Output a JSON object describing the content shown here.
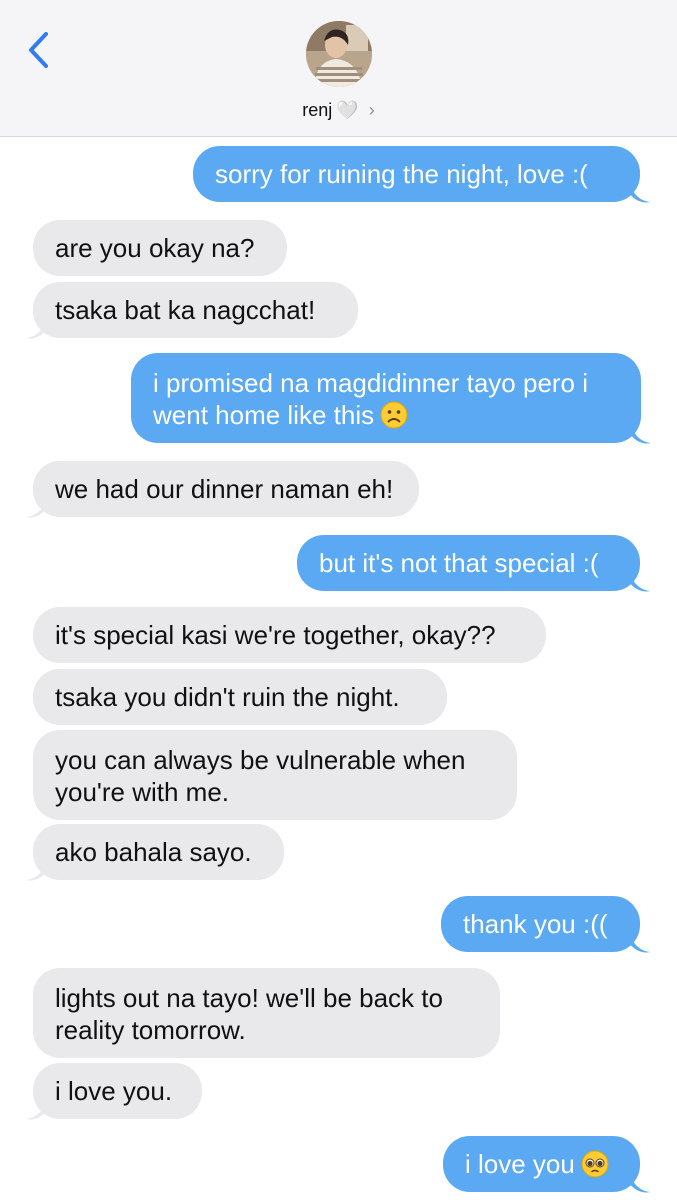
{
  "header": {
    "contact_name": "renj",
    "heart": "🤍",
    "chevron": "›",
    "icons": {
      "back": "chevron-left-icon",
      "avatar": "contact-avatar"
    },
    "colors": {
      "accent": "#2f7cf6",
      "background": "#f5f5f7"
    }
  },
  "messages": [
    {
      "from": "me",
      "lines": [
        "sorry for ruining the night, love :("
      ]
    },
    {
      "from": "them",
      "lines": [
        "are you okay na?"
      ]
    },
    {
      "from": "them",
      "lines": [
        "tsaka bat ka nagcchat!"
      ]
    },
    {
      "from": "me",
      "lines": [
        "i promised na magdidinner tayo pero i",
        "went home like this"
      ],
      "emoji": "frowning-face-emoji"
    },
    {
      "from": "them",
      "lines": [
        "we had our dinner naman eh!"
      ]
    },
    {
      "from": "me",
      "lines": [
        "but it's not that special :("
      ]
    },
    {
      "from": "them",
      "lines": [
        "it's special kasi we're together, okay??"
      ]
    },
    {
      "from": "them",
      "lines": [
        "tsaka you didn't ruin the night."
      ]
    },
    {
      "from": "them",
      "lines": [
        "you can always be vulnerable when",
        "you're with me."
      ]
    },
    {
      "from": "them",
      "lines": [
        "ako bahala sayo."
      ]
    },
    {
      "from": "me",
      "lines": [
        "thank you :(("
      ]
    },
    {
      "from": "them",
      "lines": [
        "lights out na tayo! we'll be back to",
        "reality tomorrow."
      ]
    },
    {
      "from": "them",
      "lines": [
        "i love you."
      ]
    },
    {
      "from": "me",
      "lines": [
        "i love you"
      ],
      "emoji": "pleading-face-emoji"
    }
  ],
  "colors": {
    "incoming_bubble": "#e9e9eb",
    "outgoing_bubble": "#5aa9f2"
  }
}
